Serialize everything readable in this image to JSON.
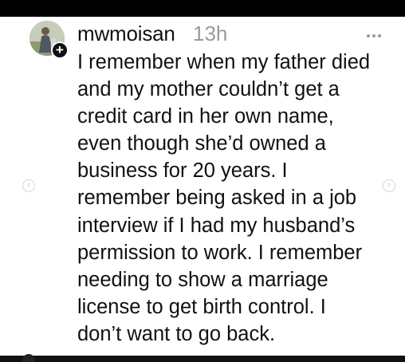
{
  "post": {
    "username": "mwmoisan",
    "timestamp": "13h",
    "body": "I remember when my father died\nand my mother couldn’t get a\ncredit card in her own name,\neven though she’d owned a\nbusiness for 20 years. I\nremember being asked in a job\ninterview if I had my husband’s\npermission to work. I remember\nneeding to show a marriage\nlicense to get birth control. I\ndon’t want to go back."
  },
  "icons": {
    "follow": "plus-icon",
    "more": "more-horizontal-icon",
    "prev": "chevron-left-icon",
    "next": "chevron-right-icon"
  },
  "glyphs": {
    "plus": "+",
    "prev": "‹",
    "next": "›"
  },
  "colors": {
    "text": "#111111",
    "muted": "#9a9a9a",
    "bars": "#000000"
  }
}
